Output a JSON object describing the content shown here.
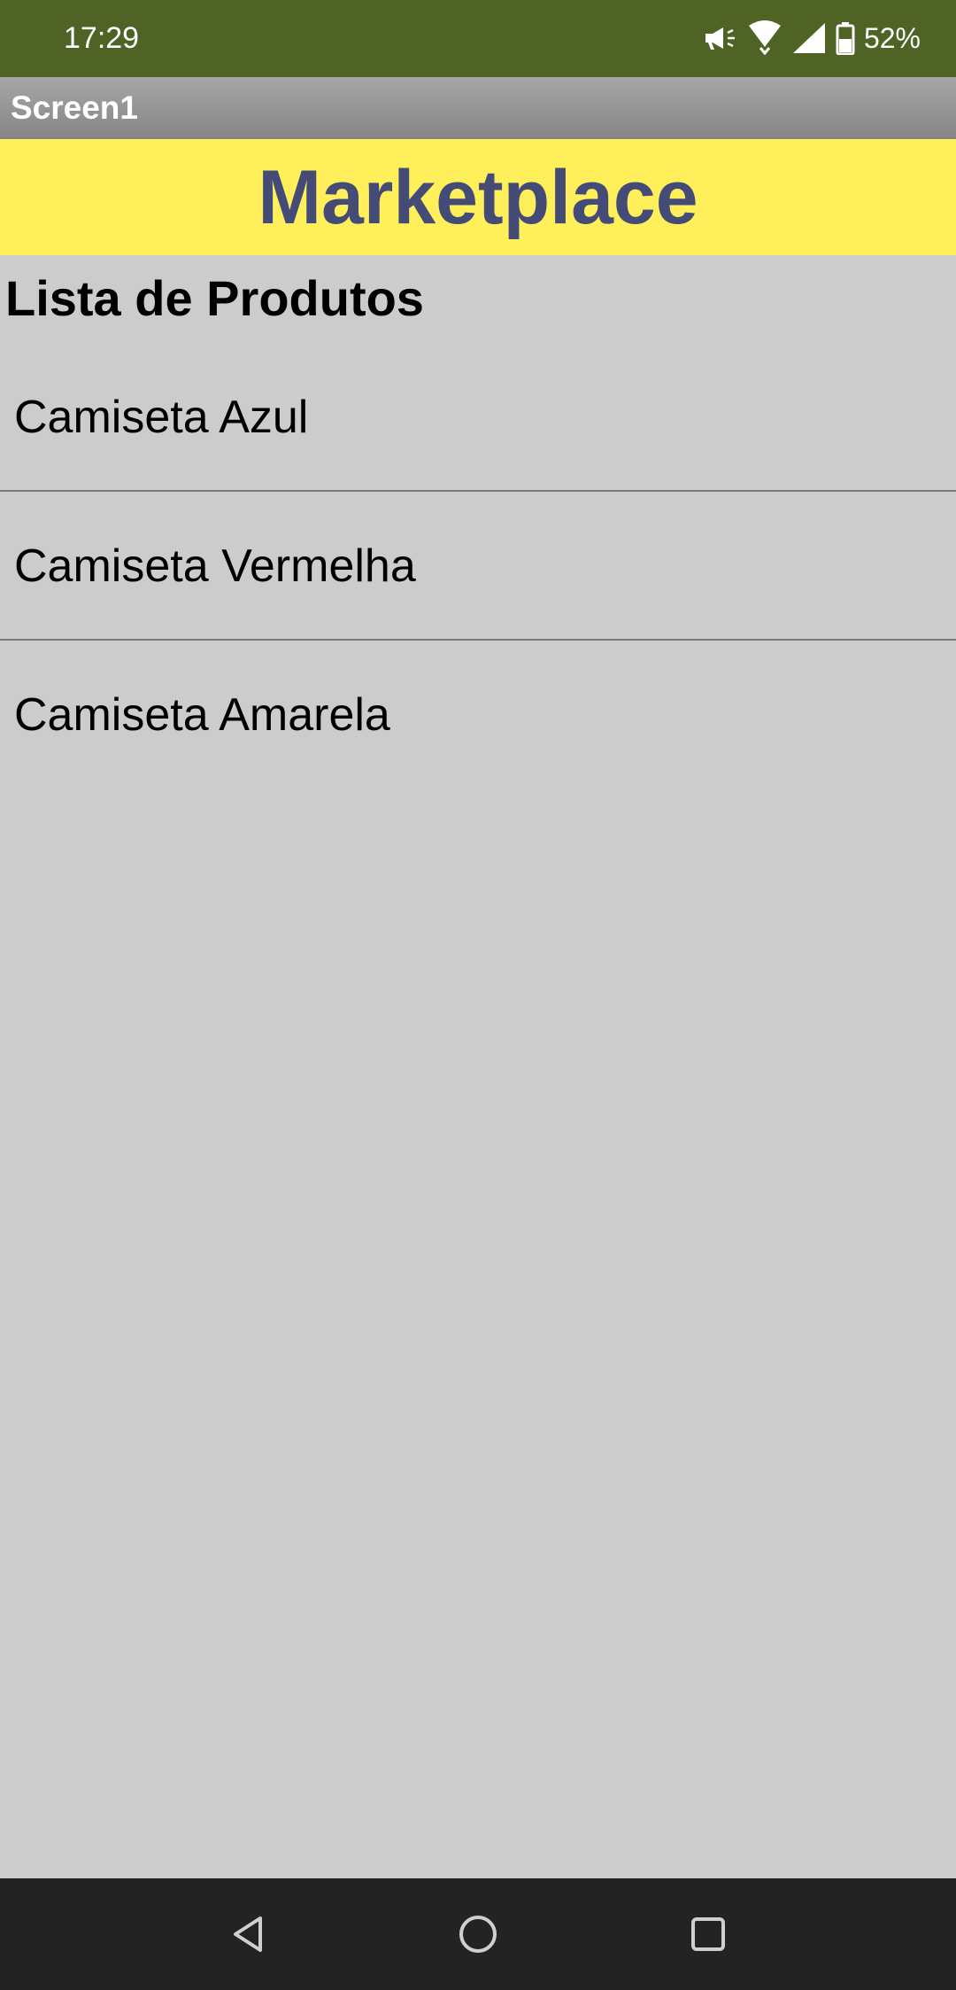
{
  "status_bar": {
    "time": "17:29",
    "battery_percent": "52%",
    "icons": [
      "megaphone-icon",
      "wifi-icon",
      "signal-icon",
      "battery-icon"
    ]
  },
  "title_bar": {
    "title": "Screen1"
  },
  "banner": {
    "title": "Marketplace"
  },
  "products": {
    "heading": "Lista de Produtos",
    "items": [
      {
        "label": "Camiseta Azul"
      },
      {
        "label": "Camiseta Vermelha"
      },
      {
        "label": "Camiseta Amarela"
      }
    ]
  },
  "nav_bar": {
    "buttons": [
      "back-icon",
      "home-icon",
      "recents-icon"
    ]
  },
  "colors": {
    "status_bar": "#4f6325",
    "banner_bg": "#fff05b",
    "banner_text": "#444b77",
    "background": "#cccccc"
  }
}
